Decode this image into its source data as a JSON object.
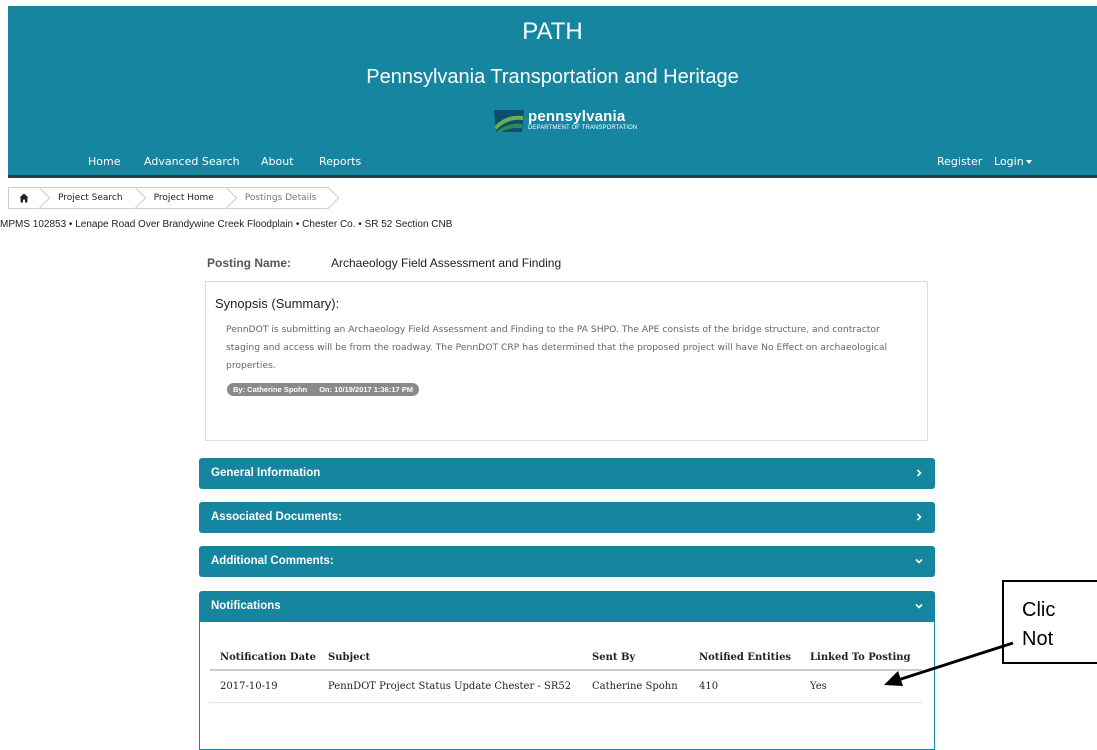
{
  "header": {
    "title": "PATH",
    "subtitle": "Pennsylvania Transportation and Heritage",
    "logo_word": "pennsylvania",
    "logo_dept": "DEPARTMENT OF TRANSPORTATION"
  },
  "nav": {
    "home": "Home",
    "advanced_search": "Advanced Search",
    "about": "About",
    "reports": "Reports",
    "register": "Register",
    "login": "Login"
  },
  "breadcrumb": {
    "items": [
      "Project Search",
      "Project Home",
      "Postings Details"
    ]
  },
  "project_line": "MPMS 102853 • Lenape Road Over Brandywine Creek Floodplain • Chester Co. • SR 52 Section CNB",
  "posting": {
    "label": "Posting Name:",
    "value": "Archaeology Field Assessment and Finding"
  },
  "synopsis": {
    "title": "Synopsis (Summary):",
    "text": "PennDOT is submitting an Archaeology Field Assessment and Finding to the PA SHPO. The APE consists of the bridge structure, and contractor staging and access will be from the roadway. The PennDOT CRP has determined that the proposed project will have No Effect on archaeological properties.",
    "by": "By: Catherine Spohn",
    "on": "On: 10/19/2017 1:36:17 PM"
  },
  "panels": {
    "general": "General Information",
    "documents": "Associated Documents:",
    "comments": "Additional Comments:",
    "notifications": "Notifications"
  },
  "notifications_table": {
    "headers": [
      "Notification Date",
      "Subject",
      "Sent By",
      "Notified Entities",
      "Linked To Posting"
    ],
    "rows": [
      [
        "2017-10-19",
        "PennDOT Project Status Update Chester - SR52",
        "Catherine Spohn",
        "410",
        "Yes"
      ]
    ]
  },
  "callout": {
    "line1": "Clic",
    "line2": "Not"
  },
  "colors": {
    "brand": "#1585a0",
    "nav_border": "#2a3a46"
  }
}
